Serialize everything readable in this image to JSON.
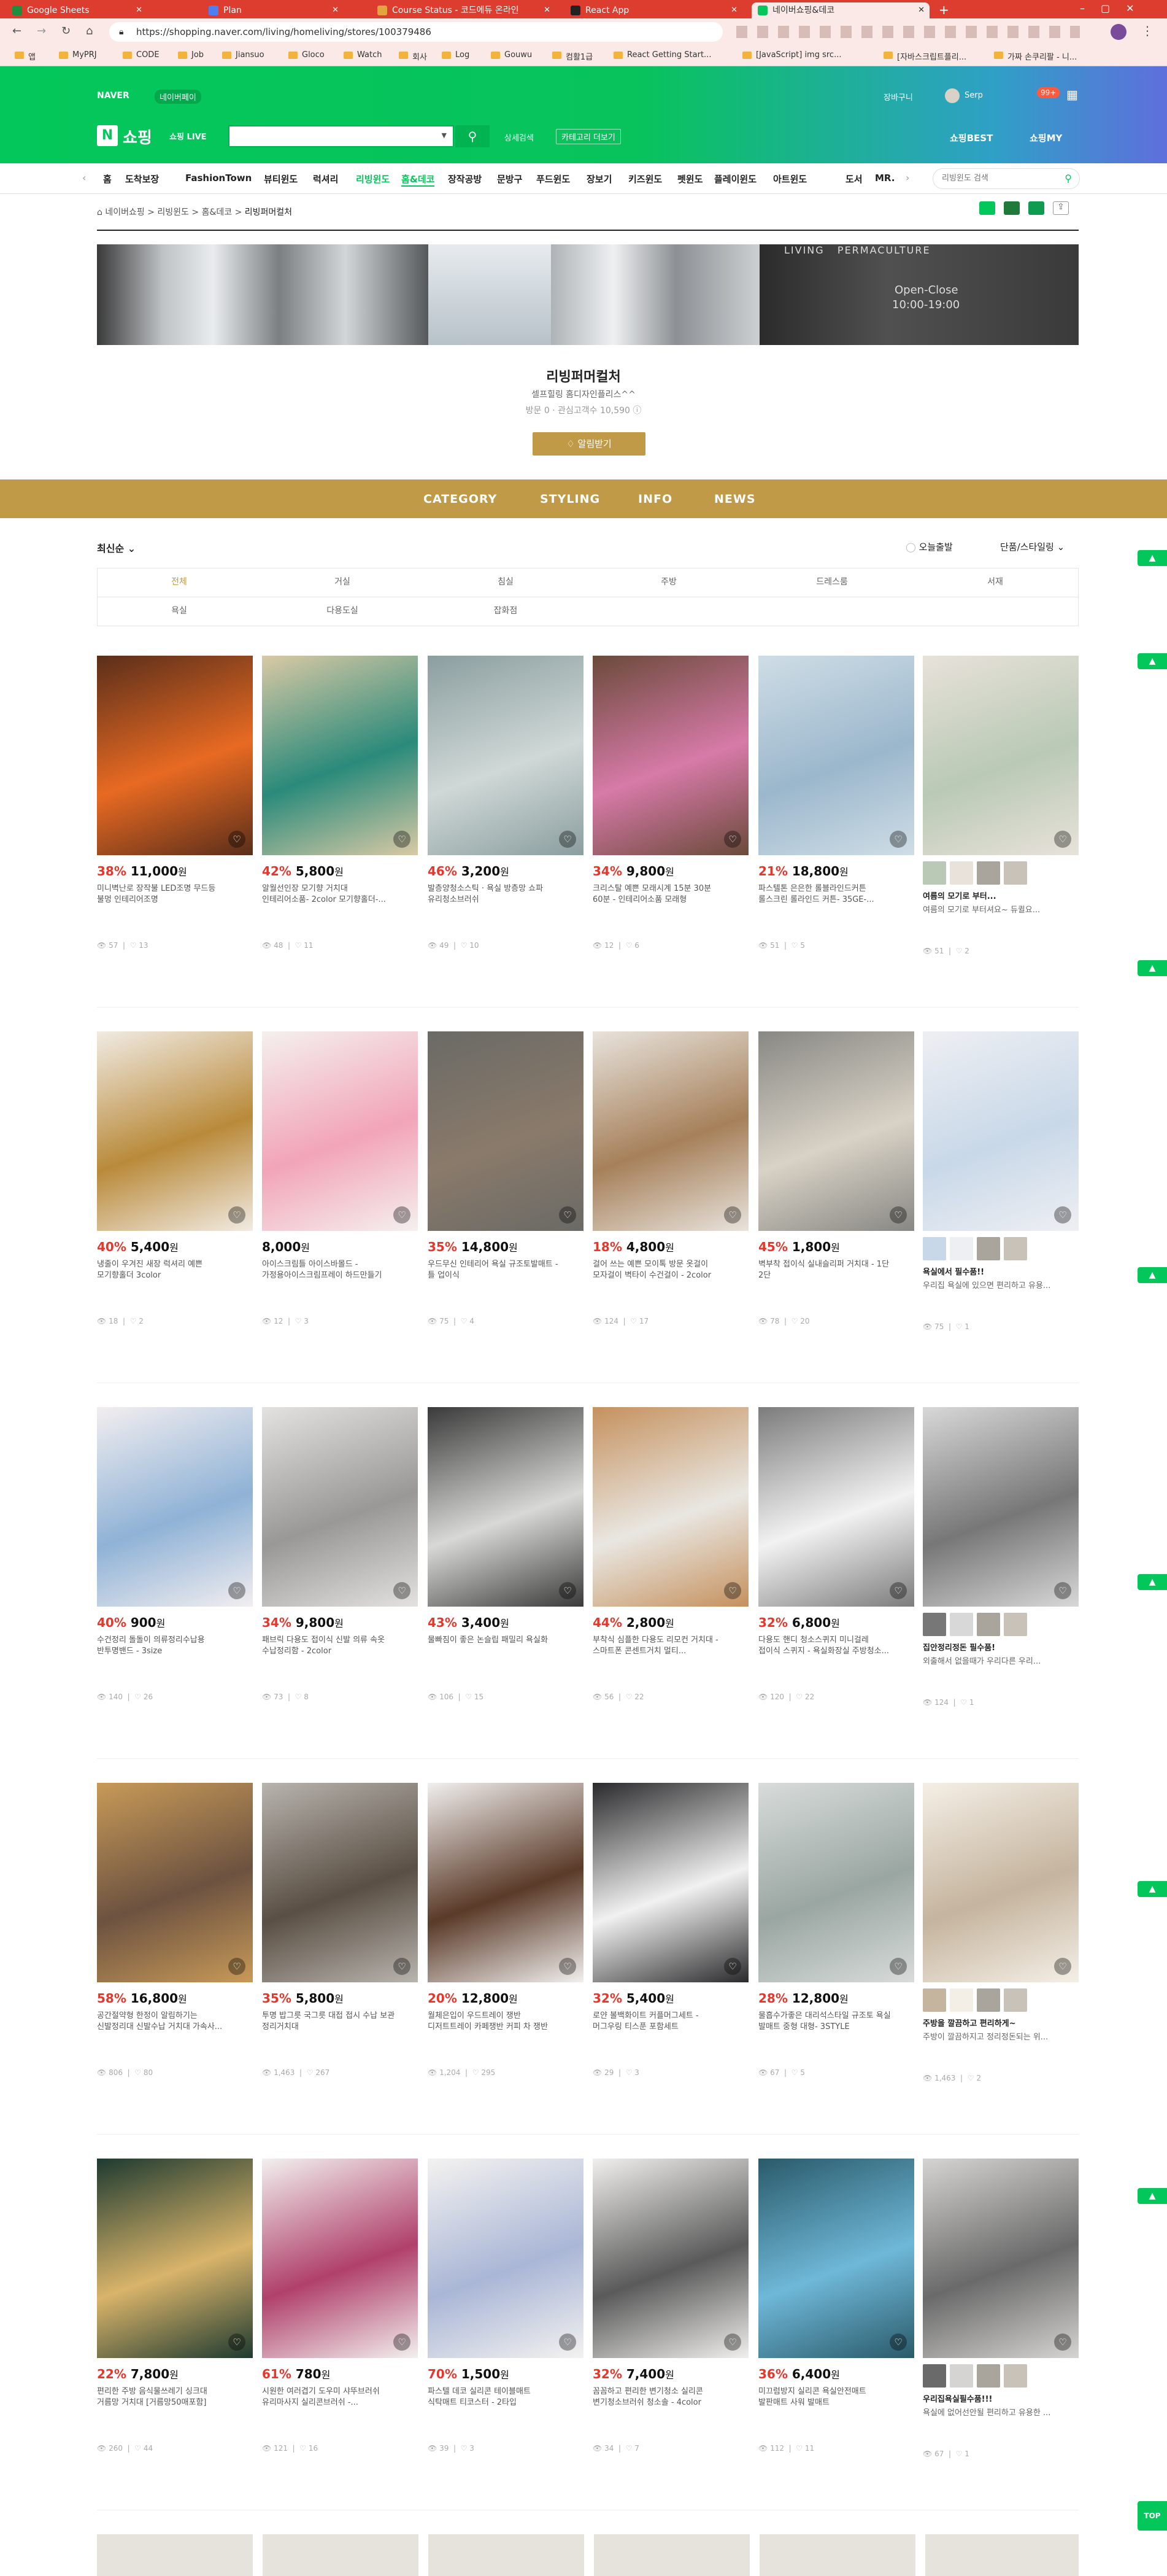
{
  "browser": {
    "tabs": [
      {
        "label": "Google Sheets",
        "fav": "#1e8e3e"
      },
      {
        "label": "Plan",
        "fav": "#4f7ef2"
      },
      {
        "label": "Course Status - 코드에듀 온라인",
        "fav": "#e5a33d"
      },
      {
        "label": "React App",
        "fav": "#222222"
      },
      {
        "label": "네이버쇼핑&데코",
        "fav": "#03c75a"
      }
    ],
    "url": "https://shopping.naver.com/living/homeliving/stores/100379486",
    "bookmarks": [
      "앱",
      "MyPRJ",
      "CODE",
      "Job",
      "Jiansuo",
      "Gloco",
      "Watch",
      "회사",
      "Log",
      "Gouwu",
      "컴활1급",
      "React Getting Start...",
      "[JavaScript] img src...",
      "[자바스크립트플리...",
      "가짜 손쿠리팔 - 니..."
    ]
  },
  "naver": {
    "brand": "NAVER",
    "shopping_tag": "네이버페이",
    "logo_n": "N",
    "logo_text": "쇼핑",
    "live_badge": "쇼핑 LIVE",
    "search_placeholder": "",
    "search_scope": "상세검색",
    "category_more": "카테고리 더보기",
    "user_cart": "장바구니",
    "user_name": "Serp",
    "user_points": "99+",
    "shopping_best": "쇼핑BEST",
    "shopping_my": "쇼핑MY",
    "gnb": [
      "홈",
      "도착보장",
      "FashionTown",
      "뷰티윈도",
      "럭셔리",
      "리빙윈도",
      "홈&데코",
      "장작공방",
      "문방구",
      "푸드윈도",
      "장보기",
      "키즈윈도",
      "펫윈도",
      "플레이윈도",
      "아트윈도",
      "도서",
      "MR."
    ],
    "gnb_search_placeholder": "리빙윈도 검색"
  },
  "store": {
    "breadcrumb": [
      "네이버쇼핑",
      "리빙윈도",
      "홈&데코",
      "리빙퍼머컬처"
    ],
    "banner_sign1": "LIVING   PERMACULTURE",
    "banner_sign2": "Open-Close",
    "banner_sign3": "10:00-19:00",
    "name": "리빙퍼머컬처",
    "desc": "셀프힐링 홈디자인플리스^^",
    "visits_label": "방문 0",
    "fans_label": "관심고객수 10,590",
    "follow_label": "알림받기",
    "cat_nav": [
      "CATEGORY",
      "STYLING",
      "INFO",
      "NEWS"
    ],
    "sort": "최신순",
    "today_delivery": "오늘출발",
    "view_mode": "단품/스타일링",
    "filters_row1": [
      "전체",
      "거실",
      "침실",
      "주방",
      "드레스룸",
      "서재"
    ],
    "filters_row2": [
      "욕실",
      "다용도실",
      "잡화점"
    ]
  },
  "products": [
    {
      "pct": "38%",
      "price": "11,000",
      "name": "미니벽난로 장작불 LED조명 무드등\n불멍 인테리어조명",
      "views": "57",
      "likes": "13",
      "img": [
        "#5a2e1a",
        "#e86a22"
      ]
    },
    {
      "pct": "42%",
      "price": "5,800",
      "name": "알월선인장 모기향 거치대\n인테리어소품- 2color 모기향홀더-...",
      "views": "48",
      "likes": "11",
      "img": [
        "#d9c9a5",
        "#2a8a7a"
      ]
    },
    {
      "pct": "46%",
      "price": "3,200",
      "name": "발층양청소스틱 · 욕실 방층망 쇼파\n유리청소브러쉬",
      "views": "49",
      "likes": "10",
      "img": [
        "#8b9ea0",
        "#cfd8d6"
      ]
    },
    {
      "pct": "34%",
      "price": "9,800",
      "name": "크리스탈 예쁜 모래시계 15분 30분\n60분 - 인테리어소품 모래형",
      "views": "12",
      "likes": "6",
      "img": [
        "#6b4a3a",
        "#d77aa8"
      ]
    },
    {
      "pct": "21%",
      "price": "18,800",
      "name": "파스텔톤 은은한 롤블라인드커튼\n롤스크린 롤라인드 커튼- 35GE-...",
      "views": "51",
      "likes": "5",
      "img": [
        "#cfdde6",
        "#9bb7cc"
      ]
    },
    {
      "review": true,
      "title": "여름의 모기로 부터...",
      "sub": "여름의 모기로 부터셔요~ 듀퀼요...",
      "views": "51",
      "likes": "2",
      "img": [
        "#e8e2da",
        "#b9c9b5"
      ]
    },
    {
      "pct": "40%",
      "price": "5,400",
      "name": "냉줄이 우겨진 새장 럭셔리 예쁜\n모기향홀더 3color",
      "views": "18",
      "likes": "2",
      "img": [
        "#f1ebe3",
        "#b98a3a"
      ]
    },
    {
      "pct": "",
      "price": "8,000",
      "name": "아이스크림틀 아이스바몰드 -\n가정용아이스크림프레이 하드만들기",
      "views": "12",
      "likes": "3",
      "img": [
        "#f4f0ee",
        "#f2a4b8"
      ]
    },
    {
      "pct": "35%",
      "price": "14,800",
      "name": "우드무신 인테리어 욕실 규조토발매트 -\n틀 업이식",
      "views": "75",
      "likes": "4",
      "img": [
        "#6a6a66",
        "#8a7a6a"
      ]
    },
    {
      "pct": "18%",
      "price": "4,800",
      "name": "걸어 쓰는 예쁜 모이톡 방문 옷걸이\n모자걸이 벽타이 수건걸이 - 2color",
      "views": "124",
      "likes": "17",
      "img": [
        "#e8e3dc",
        "#a6805a"
      ]
    },
    {
      "pct": "45%",
      "price": "1,800",
      "name": "벽부착 접이식 실내슬리퍼 거치대 - 1단\n2단",
      "views": "78",
      "likes": "20",
      "img": [
        "#888884",
        "#d9d2c6"
      ]
    },
    {
      "review": true,
      "title": "욕실에서 필수품!!",
      "sub": "우리집 욕실에 있으면 편리하고 유용...",
      "views": "75",
      "likes": "1",
      "img": [
        "#eeeff3",
        "#c8d8e8"
      ]
    },
    {
      "pct": "40%",
      "price": "900",
      "name": "수건정리 돌돌이 의류정리수납용\n반투명밴드 - 3size",
      "views": "140",
      "likes": "26",
      "img": [
        "#f2eef0",
        "#8fb2d6"
      ]
    },
    {
      "pct": "34%",
      "price": "9,800",
      "name": "패브릭 다용도 접이식 신발 의류 속옷\n수납정리함 - 2color",
      "views": "73",
      "likes": "8",
      "img": [
        "#e4e2e0",
        "#9a9896"
      ]
    },
    {
      "pct": "43%",
      "price": "3,400",
      "name": "물빠짐이 좋은 논슬립 패밀리 욕실화",
      "views": "106",
      "likes": "15",
      "img": [
        "#3a3a3a",
        "#d8d8d6"
      ]
    },
    {
      "pct": "44%",
      "price": "2,800",
      "name": "부착식 심플한 다용도 리모컨 거치대 -\n스마트폰 콘센트거치 멀티...",
      "views": "56",
      "likes": "22",
      "img": [
        "#c5915e",
        "#e9e7e2"
      ]
    },
    {
      "pct": "32%",
      "price": "6,800",
      "name": "다용도 핸디 청소스퀴지 미니걸레\n접이식 스퀴지 - 욕실화장실 주방청소...",
      "views": "120",
      "likes": "22",
      "img": [
        "#7c7c7c",
        "#f2f2f2"
      ]
    },
    {
      "review": true,
      "title": "집안정리정돈 필수품!",
      "sub": "외출해서 없을때가 우리다른 우리...",
      "views": "124",
      "likes": "1",
      "img": [
        "#d8d8d8",
        "#777777"
      ]
    },
    {
      "pct": "58%",
      "price": "16,800",
      "name": "공간절약형 한정이 알림하기는\n신발정리대 신발수납 거치대 가속사...",
      "views": "806",
      "likes": "80",
      "img": [
        "#c89a58",
        "#6c5240"
      ]
    },
    {
      "pct": "35%",
      "price": "5,800",
      "name": "투명 밥그릇 국그릇 대접 접시 수납 보관\n정리거치대",
      "views": "1,463",
      "likes": "267",
      "img": [
        "#b8b4ae",
        "#5a4f44"
      ]
    },
    {
      "pct": "20%",
      "price": "12,800",
      "name": "월체은입이 우드트레이 쟁반\n디저트트레이 카페쟁반 커피 차 쟁반",
      "views": "1,204",
      "likes": "295",
      "img": [
        "#f1efee",
        "#5a3a28"
      ]
    },
    {
      "pct": "32%",
      "price": "5,400",
      "name": "로얀 볼백화이트 커플머그세트 -\n머그우링 티스푼 포함세트",
      "views": "29",
      "likes": "3",
      "img": [
        "#2a2a2c",
        "#f1f1f1"
      ]
    },
    {
      "pct": "28%",
      "price": "12,800",
      "name": "물흡수가좋은 대리석스타일 규조토 욕실\n발매트 중형 대형- 3STYLE",
      "views": "67",
      "likes": "5",
      "img": [
        "#d8dcda",
        "#9aa6a2"
      ]
    },
    {
      "review": true,
      "title": "주방을 깔끔하고 편리하게~",
      "sub": "주방이 깔끔하지고 정리정돈되는 위...",
      "views": "1,463",
      "likes": "2",
      "img": [
        "#f4efe6",
        "#c5b49e"
      ]
    },
    {
      "pct": "22%",
      "price": "7,800",
      "name": "편리한 주방 음식물쓰레기 싱크대\n거름망 거치대 [거름망50매포함]",
      "views": "260",
      "likes": "44",
      "img": [
        "#1e3a30",
        "#d9b46a"
      ]
    },
    {
      "pct": "61%",
      "price": "780",
      "name": "시원한 여러겹기 도우미 샤뚜브러쉬\n유리마사지 실리콘브러쉬 -...",
      "views": "121",
      "likes": "16",
      "img": [
        "#f2f0ef",
        "#b0406a"
      ]
    },
    {
      "pct": "70%",
      "price": "1,500",
      "name": "파스텔 데코 실리콘 테이블매트\n식탁매트 티코스터 - 2타입",
      "views": "39",
      "likes": "3",
      "img": [
        "#f4f2f0",
        "#a9b6d6"
      ]
    },
    {
      "pct": "32%",
      "price": "7,400",
      "name": "꼼꼼하고 편리한 변기청소 실리콘\n변기청소브러쉬 청소솔 - 4color",
      "views": "34",
      "likes": "7",
      "img": [
        "#f0efed",
        "#5a5a5a"
      ]
    },
    {
      "pct": "36%",
      "price": "6,400",
      "name": "미끄럼방지 실리콘 욕실안전매트\n발판매트 사워 발매트",
      "views": "112",
      "likes": "11",
      "img": [
        "#2a5a6a",
        "#6fb8d8"
      ]
    },
    {
      "review": true,
      "title": "우리집욕실필수품!!!",
      "sub": "욕실에 없어선안될 편리하고 유용한 ...",
      "views": "67",
      "likes": "1",
      "img": [
        "#d6d4d2",
        "#6a6a6a"
      ]
    }
  ],
  "side_tabs": [
    "▲",
    "▲",
    "▲",
    "▲",
    "▲",
    "▲",
    "▲"
  ],
  "top_button": "TOP",
  "colors": {
    "naver_green": "#03c75a",
    "discount_red": "#e8362b",
    "store_gold": "#c19a47",
    "chrome_red": "#dc3d2e"
  }
}
